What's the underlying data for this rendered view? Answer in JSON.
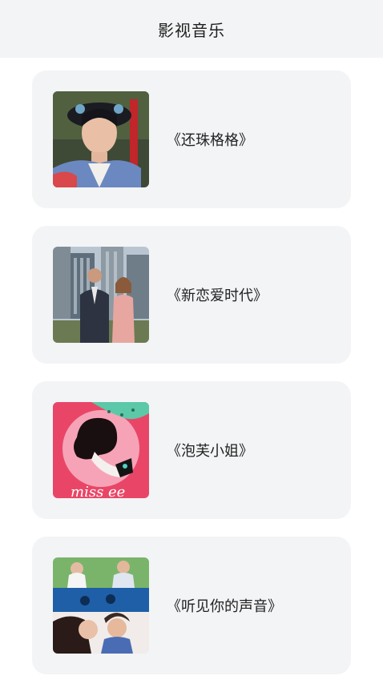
{
  "header": {
    "title": "影视音乐"
  },
  "items": [
    {
      "title": "《还珠格格》",
      "cover": "period-drama-portrait-cover"
    },
    {
      "title": "《新恋爱时代》",
      "cover": "couple-city-cover"
    },
    {
      "title": "《泡芙小姐》",
      "cover": "miss-puff-cartoon-cover"
    },
    {
      "title": "《听见你的声音》",
      "cover": "drama-collage-cover"
    }
  ],
  "cover_art": {
    "miss_text": "miss ee"
  }
}
